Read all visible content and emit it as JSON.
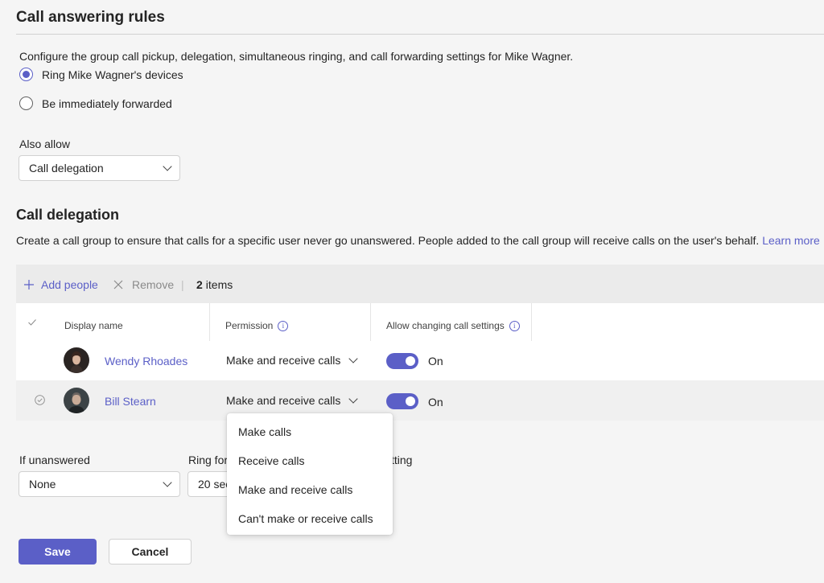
{
  "page": {
    "title": "Call answering rules",
    "description": "Configure the group call pickup, delegation, simultaneous ringing, and call forwarding settings for Mike Wagner."
  },
  "radio_options": [
    {
      "label": "Ring Mike Wagner's devices",
      "selected": true
    },
    {
      "label": "Be immediately forwarded",
      "selected": false
    }
  ],
  "also_allow": {
    "label": "Also allow",
    "value": "Call delegation"
  },
  "delegation": {
    "title": "Call delegation",
    "description": "Create a call group to ensure that calls for a specific user never go unanswered. People added to the call group will receive calls on the user's behalf.",
    "learn_more": "Learn more"
  },
  "toolbar": {
    "add_people": "Add people",
    "remove": "Remove",
    "count_number": "2",
    "count_suffix": "items"
  },
  "table": {
    "columns": [
      "Display name",
      "Permission",
      "Allow changing call settings"
    ],
    "rows": [
      {
        "name": "Wendy Rhoades",
        "permission": "Make and receive calls",
        "toggle_label": "On",
        "toggle_on": true,
        "selected": false
      },
      {
        "name": "Bill Stearn",
        "permission": "Make and receive calls",
        "toggle_label": "On",
        "toggle_on": true,
        "selected": true
      }
    ]
  },
  "permission_menu": {
    "items": [
      "Make calls",
      "Receive calls",
      "Make and receive calls",
      "Can't make or receive calls"
    ]
  },
  "unanswered": {
    "label": "If unanswered",
    "value": "None",
    "ring_label_partial": "Ring for",
    "ring_value_partial": "20 sec",
    "setting_partial": "tting"
  },
  "actions": {
    "save": "Save",
    "cancel": "Cancel"
  },
  "colors": {
    "accent": "#5b5fc7",
    "background": "#f5f5f5"
  }
}
